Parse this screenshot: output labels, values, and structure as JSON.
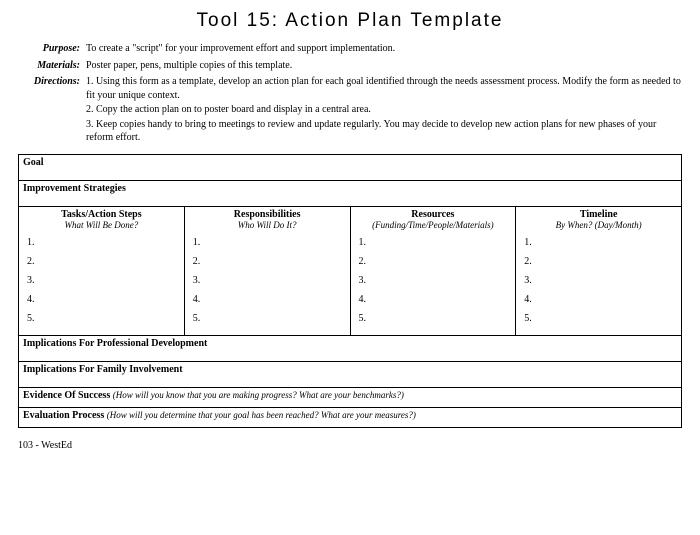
{
  "title": "Tool 15: Action Plan Template",
  "meta": {
    "purpose_label": "Purpose:",
    "purpose": "To create a \"script\" for your improvement effort and support implementation.",
    "materials_label": "Materials:",
    "materials": "Poster paper, pens, multiple copies of this template.",
    "directions_label": "Directions:",
    "directions": [
      "1.   Using this form as a template, develop an action plan for each goal identified through the needs assessment process.  Modify the form as needed to fit your unique context.",
      "2.   Copy the action plan on to poster board and display in a central area.",
      "3.   Keep copies handy to bring to meetings to review and update regularly. You may decide to develop new action plans for new phases of your reform effort."
    ]
  },
  "sections": {
    "goal": "Goal",
    "improvement": "Improvement Strategies",
    "implications_pd": "Implications For Professional Development",
    "implications_family": "Implications For Family Involvement",
    "evidence_head": "Evidence Of Success",
    "evidence_sub": "(How will you know that you are making progress? What are your benchmarks?)",
    "evaluation_head": "Evaluation Process",
    "evaluation_sub": "(How will you determine that your goal has been reached? What are your measures?)"
  },
  "columns": {
    "c1_head": "Tasks/Action Steps",
    "c1_sub": "What Will Be Done?",
    "c2_head": "Responsibilities",
    "c2_sub": "Who Will Do It?",
    "c3_head": "Resources",
    "c3_sub": "(Funding/Time/People/Materials)",
    "c4_head": "Timeline",
    "c4_sub": "By When? (Day/Month)"
  },
  "numbers": [
    "1.",
    "2.",
    "3.",
    "4.",
    "5."
  ],
  "footer": "103 - WestEd"
}
